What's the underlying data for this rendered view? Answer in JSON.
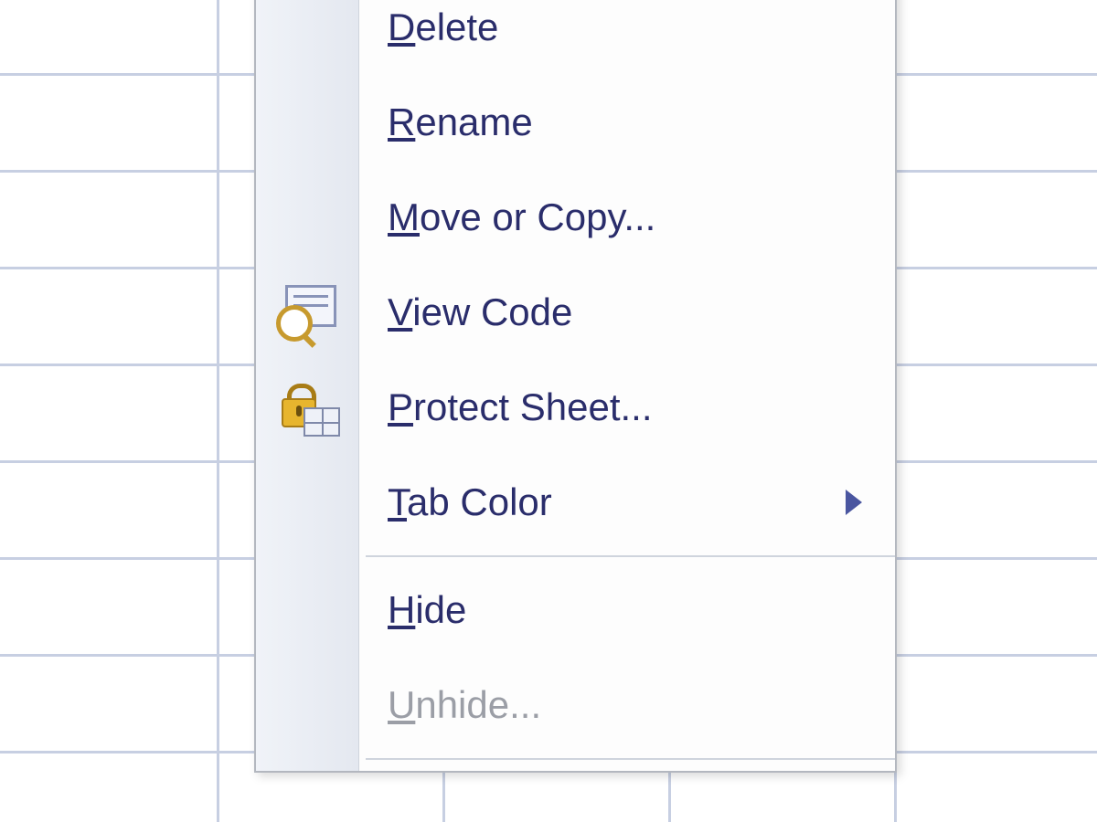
{
  "context_menu": {
    "items": [
      {
        "label": "Delete",
        "hotkey_index": 0,
        "icon": null,
        "has_submenu": false,
        "enabled": true
      },
      {
        "label": "Rename",
        "hotkey_index": 0,
        "icon": null,
        "has_submenu": false,
        "enabled": true
      },
      {
        "label": "Move or Copy...",
        "hotkey_index": 0,
        "icon": null,
        "has_submenu": false,
        "enabled": true
      },
      {
        "label": "View Code",
        "hotkey_index": 0,
        "icon": "view-code",
        "has_submenu": false,
        "enabled": true
      },
      {
        "label": "Protect Sheet...",
        "hotkey_index": 0,
        "icon": "protect-sheet",
        "has_submenu": false,
        "enabled": true
      },
      {
        "label": "Tab Color",
        "hotkey_index": 0,
        "icon": null,
        "has_submenu": true,
        "enabled": true
      },
      {
        "separator": true
      },
      {
        "label": "Hide",
        "hotkey_index": 0,
        "icon": null,
        "has_submenu": false,
        "enabled": true
      },
      {
        "label": "Unhide...",
        "hotkey_index": 0,
        "icon": null,
        "has_submenu": false,
        "enabled": false
      },
      {
        "separator": true
      }
    ]
  }
}
